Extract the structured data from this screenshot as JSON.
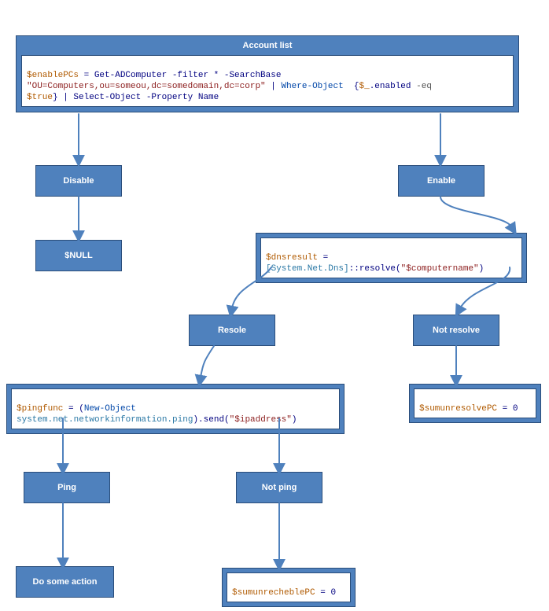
{
  "nodes": {
    "account_list": {
      "title": "Account list",
      "code": {
        "v1": "$enablePCs",
        "p1": " = Get-ADComputer -filter * -SearchBase",
        "nl1": "\n",
        "s1": "\"OU=Computers,ou=someou,dc=somedomain,dc=corp\"",
        "p2": " | ",
        "kw1": "Where-Object",
        "p3": "  {",
        "v2": "$_",
        "p4": ".enabled ",
        "op": "-eq",
        "nl2": "\n",
        "v3": "$true",
        "p5": "} | Select-Object -Property ",
        "name": "Name"
      }
    },
    "disable": {
      "label": "Disable"
    },
    "enable": {
      "label": "Enable"
    },
    "null": {
      "label": "$NULL"
    },
    "dns": {
      "code": {
        "v1": "$dnsresult",
        "p1": " =",
        "nl": "\n",
        "t1": "[System.Net.Dns]",
        "p2": "::resolve(",
        "s1": "\"$computername\"",
        "p3": ")"
      }
    },
    "resole": {
      "label": "Resole"
    },
    "notresolve": {
      "label": "Not resolve"
    },
    "ping": {
      "code": {
        "v1": "$pingfunc",
        "p1": " = (",
        "kw1": "New-Object",
        "nl": "\n",
        "t1": "system.net.networkinformation.ping",
        "p2": ").send(",
        "s1": "\"$ipaddress\"",
        "p3": ")"
      }
    },
    "pinglbl": {
      "label": "Ping"
    },
    "notping": {
      "label": "Not ping"
    },
    "dosome": {
      "label": "Do some action"
    },
    "sumunreach": {
      "code": {
        "v1": "$sumunrecheblePC",
        "p1": " = ",
        "n1": "0"
      }
    },
    "sumunresolve": {
      "code": {
        "v1": "$sumunresolvePC",
        "p1": " = ",
        "n1": "0"
      }
    }
  }
}
